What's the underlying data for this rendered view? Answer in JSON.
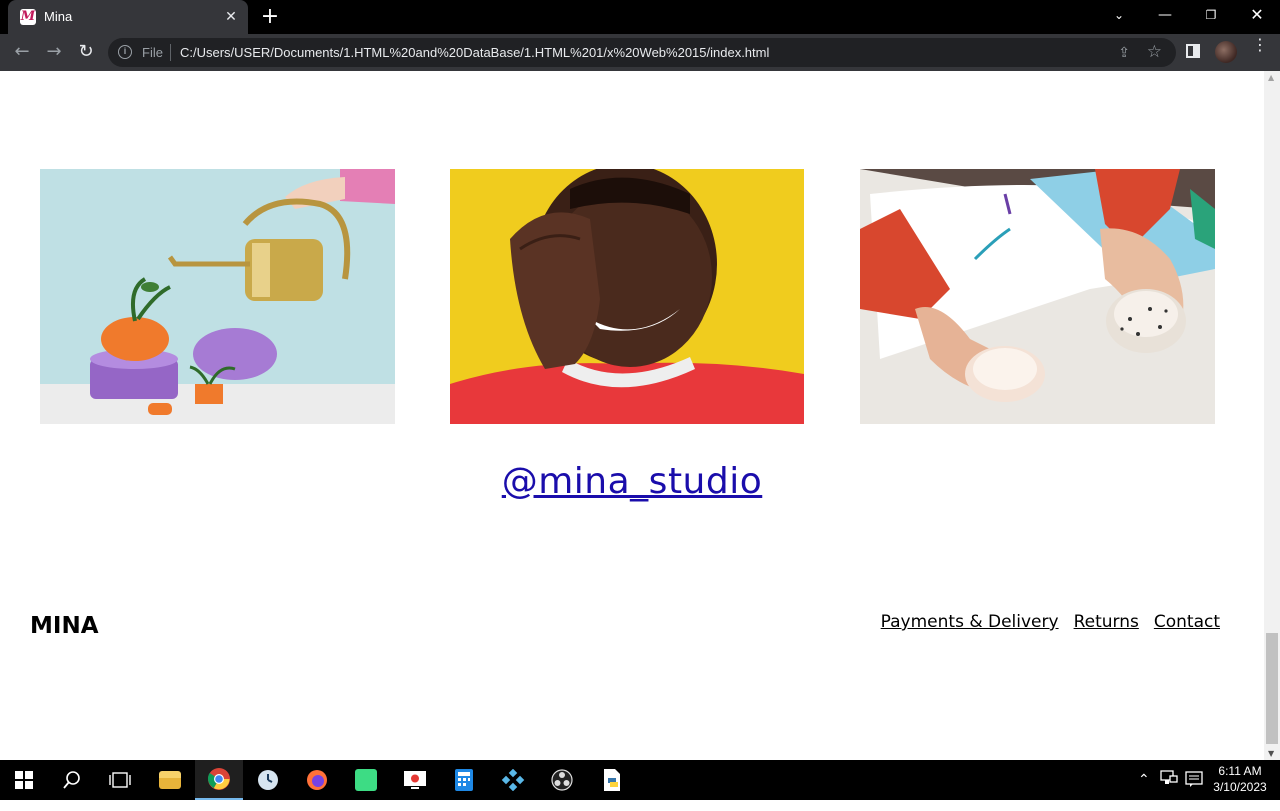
{
  "browser": {
    "tab_title": "Mina",
    "favicon_letter": "M",
    "address_scheme": "File",
    "address_url": "C:/Users/USER/Documents/1.HTML%20and%20DataBase/1.HTML%201/x%20Web%2015/index.html"
  },
  "page": {
    "instagram_handle": "@mina_studio",
    "footer": {
      "logo": "MINA",
      "links": [
        "Payments & Delivery",
        "Returns",
        "Contact"
      ]
    },
    "gallery": [
      {
        "icon": "watering-can-photo"
      },
      {
        "icon": "smiling-man-photo"
      },
      {
        "icon": "hands-cups-photo"
      }
    ]
  },
  "taskbar": {
    "time": "6:11 AM",
    "date": "3/10/2023"
  },
  "colors": {
    "link": "#1a0dab",
    "chrome_dark": "#35363a"
  }
}
